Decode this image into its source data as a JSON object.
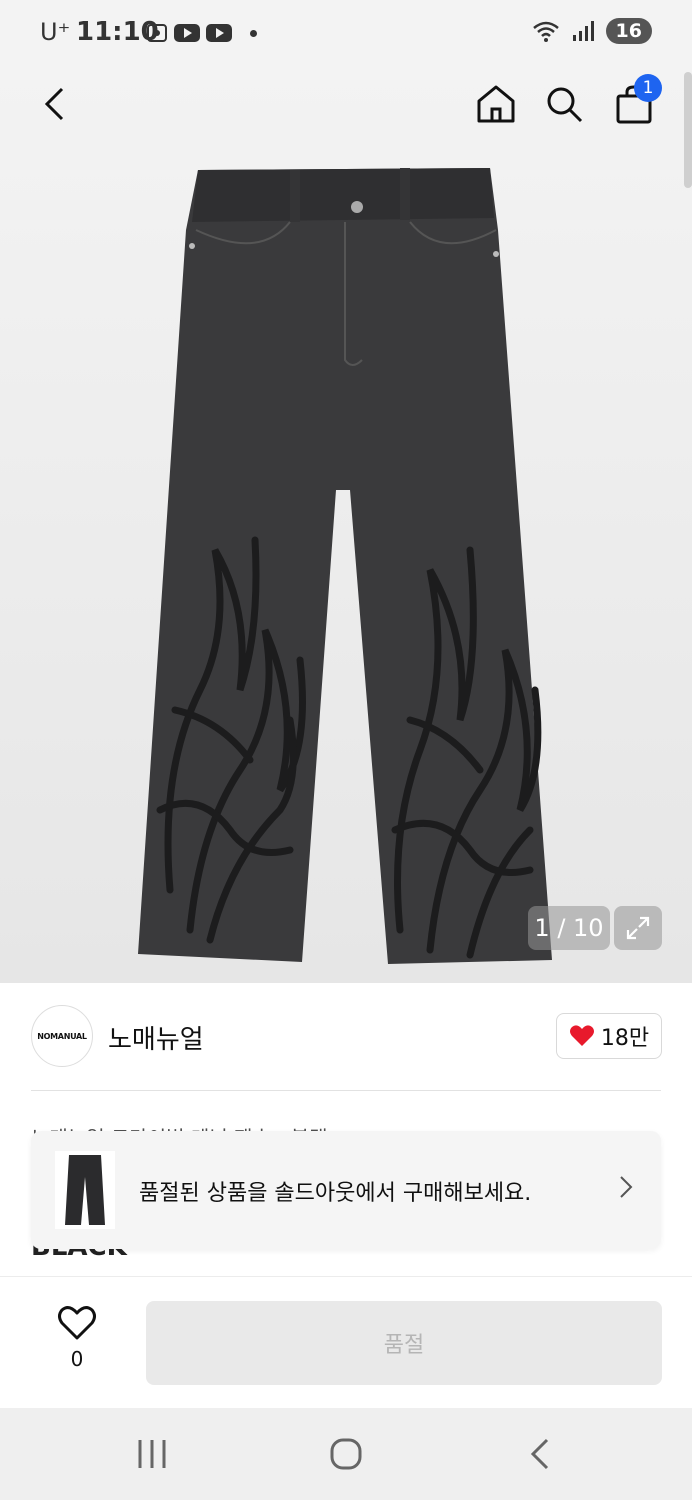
{
  "status_bar": {
    "carrier": "U⁺",
    "time": "11:10",
    "battery": "16"
  },
  "header": {
    "cart_count": "1"
  },
  "gallery": {
    "pager": "1 / 10"
  },
  "brand": {
    "logo_text": "NOMANUAL",
    "name": "노매뉴얼",
    "likes": "18만"
  },
  "product": {
    "title_partial": "노매뉴얼 트라이벌 데님 팬츠 - 블랙",
    "color_partial": "BLACK"
  },
  "soldout_banner": {
    "text": "품절된 상품을 솔드아웃에서 구매해보세요."
  },
  "bottom_bar": {
    "wish_count": "0",
    "buy_label": "품절"
  },
  "colors": {
    "accent_blue": "#1e64f0",
    "heart_red": "#e8192c",
    "denim": "#3a3a3c"
  }
}
